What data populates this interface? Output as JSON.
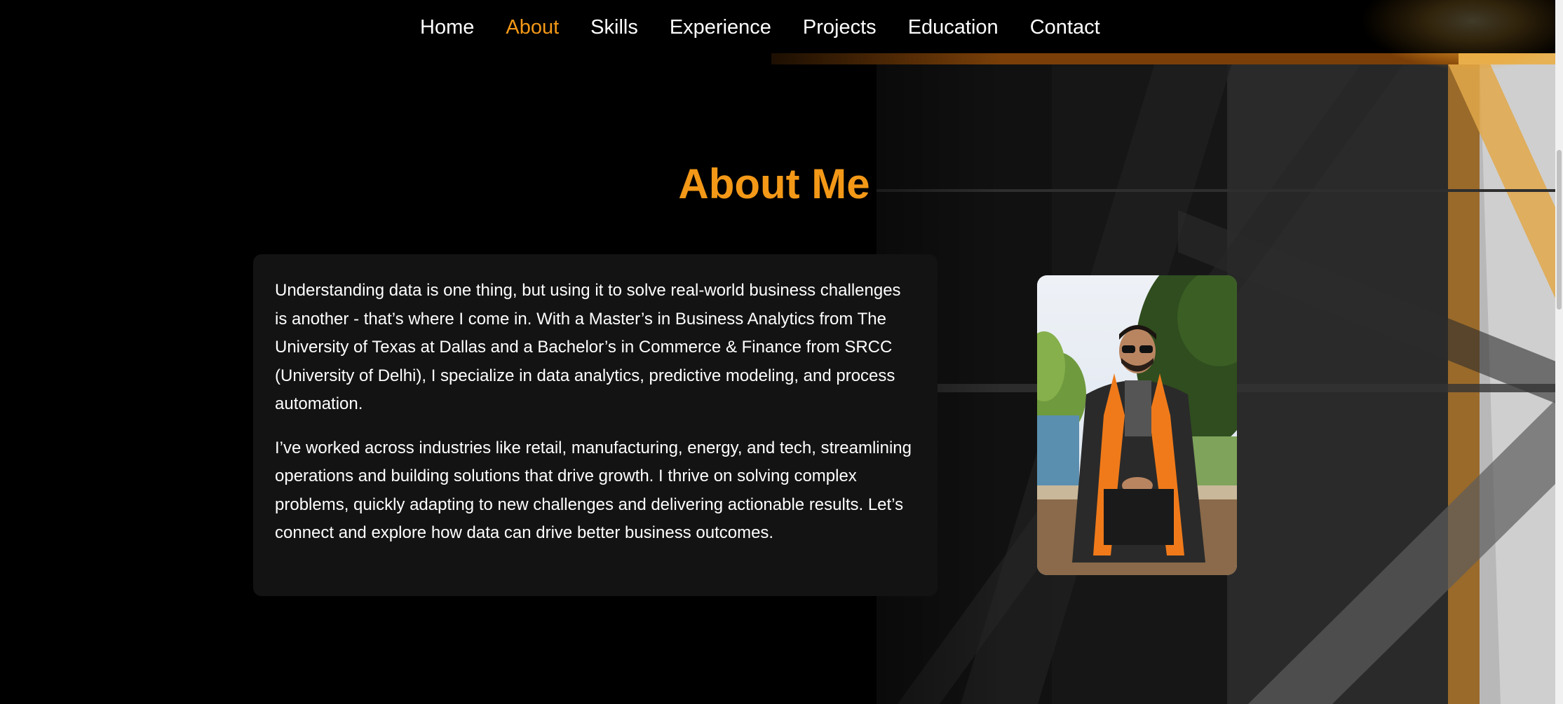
{
  "nav": {
    "items": [
      {
        "label": "Home",
        "active": false
      },
      {
        "label": "About",
        "active": true
      },
      {
        "label": "Skills",
        "active": false
      },
      {
        "label": "Experience",
        "active": false
      },
      {
        "label": "Projects",
        "active": false
      },
      {
        "label": "Education",
        "active": false
      },
      {
        "label": "Contact",
        "active": false
      }
    ]
  },
  "about": {
    "title": "About Me",
    "paragraph_1": "Understanding data is one thing, but using it to solve real-world business challenges is another - that’s where I come in. With a Master’s in Business Analytics from The University of Texas at Dallas and a Bachelor’s in Commerce & Finance from SRCC (University of Delhi), I specialize in data analytics, predictive modeling, and process automation.",
    "paragraph_2": "I’ve worked across industries like retail, manufacturing, energy, and tech, streamlining operations and building solutions that drive growth. I thrive on solving complex problems, quickly adapting to new challenges and delivering actionable results. Let’s connect and explore how data can drive better business outcomes."
  },
  "colors": {
    "accent": "#f39817",
    "background": "#000000",
    "card": "#131313",
    "text": "#ffffff"
  }
}
